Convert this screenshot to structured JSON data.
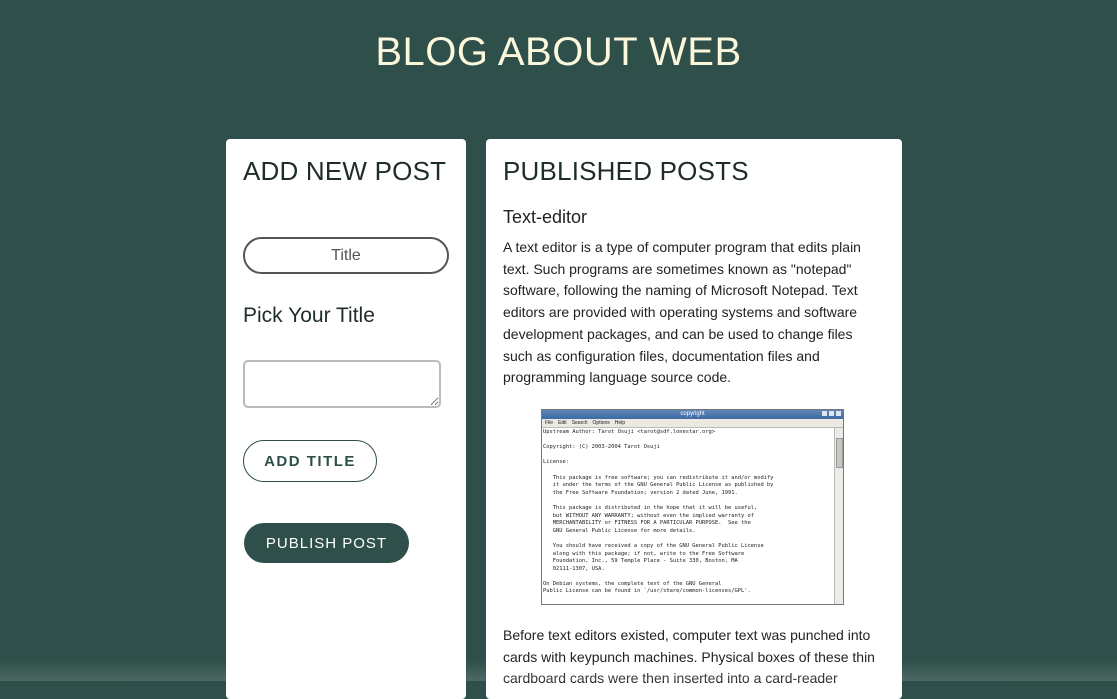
{
  "site": {
    "title": "BLOG ABOUT WEB"
  },
  "colors": {
    "background": "#2f4f4a",
    "title_text": "#fbf7dc",
    "card": "#ffffff",
    "accent": "#2f4f4a"
  },
  "add_post": {
    "heading": "ADD NEW POST",
    "title_input_placeholder": "Title",
    "title_input_value": "",
    "pick_label": "Pick Your Title",
    "body_textarea_value": "",
    "add_title_label": "ADD TITLE",
    "publish_label": "PUBLISH POST"
  },
  "published": {
    "heading": "PUBLISHED POSTS",
    "posts": [
      {
        "title": "Text-editor",
        "paragraph_1": "A text editor is a type of computer program that edits plain text. Such programs are sometimes known as \"notepad\" software, following the naming of Microsoft Notepad. Text editors are provided with operating systems and software development packages, and can be used to change files such as configuration files, documentation files and programming language source code.",
        "image": {
          "window_title": "copyright",
          "menu": [
            "File",
            "Edit",
            "Search",
            "Options",
            "Help"
          ],
          "content": "Upstream Author: Tarot Osuji <tarot@sdf.lonestar.org>\n\nCopyright: (C) 2003-2004 Tarot Osuji\n\nLicense:\n\n   This package is free software; you can redistribute it and/or modify\n   it under the terms of the GNU General Public License as published by\n   the Free Software Foundation; version 2 dated June, 1991.\n\n   This package is distributed in the hope that it will be useful,\n   but WITHOUT ANY WARRANTY; without even the implied warranty of\n   MERCHANTABILITY or FITNESS FOR A PARTICULAR PURPOSE.  See the\n   GNU General Public License for more details.\n\n   You should have received a copy of the GNU General Public License\n   along with this package; if not, write to the Free Software\n   Foundation, Inc., 59 Temple Place - Suite 330, Boston, MA\n   02111-1307, USA.\n\nOn Debian systems, the complete text of the GNU General\nPublic License can be found in `/usr/share/common-licenses/GPL'."
        },
        "paragraph_2": "Before text editors existed, computer text was punched into cards with keypunch machines. Physical boxes of these thin cardboard cards were then inserted into a card-reader"
      }
    ]
  }
}
